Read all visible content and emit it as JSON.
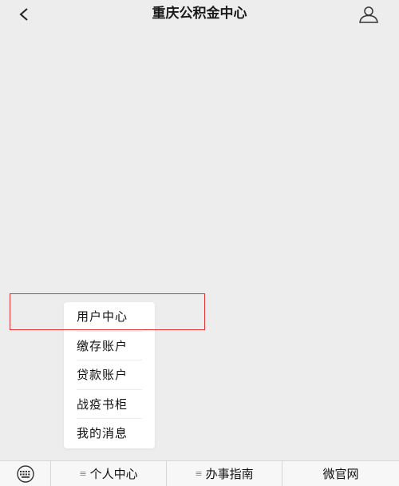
{
  "header": {
    "title": "重庆公积金中心"
  },
  "popup_menu": {
    "items": [
      {
        "label": "用户中心"
      },
      {
        "label": "缴存账户"
      },
      {
        "label": "贷款账户"
      },
      {
        "label": "战疫书柜"
      },
      {
        "label": "我的消息"
      }
    ],
    "highlight_color": "#e03232"
  },
  "bottom_bar": {
    "hamburger_glyph": "≡",
    "tabs": [
      {
        "label": "个人中心",
        "has_submenu": true
      },
      {
        "label": "办事指南",
        "has_submenu": true
      },
      {
        "label": "微官网",
        "has_submenu": false
      }
    ]
  },
  "icons": {
    "back": "chevron-left-icon",
    "user": "user-icon",
    "keyboard": "keyboard-icon"
  }
}
